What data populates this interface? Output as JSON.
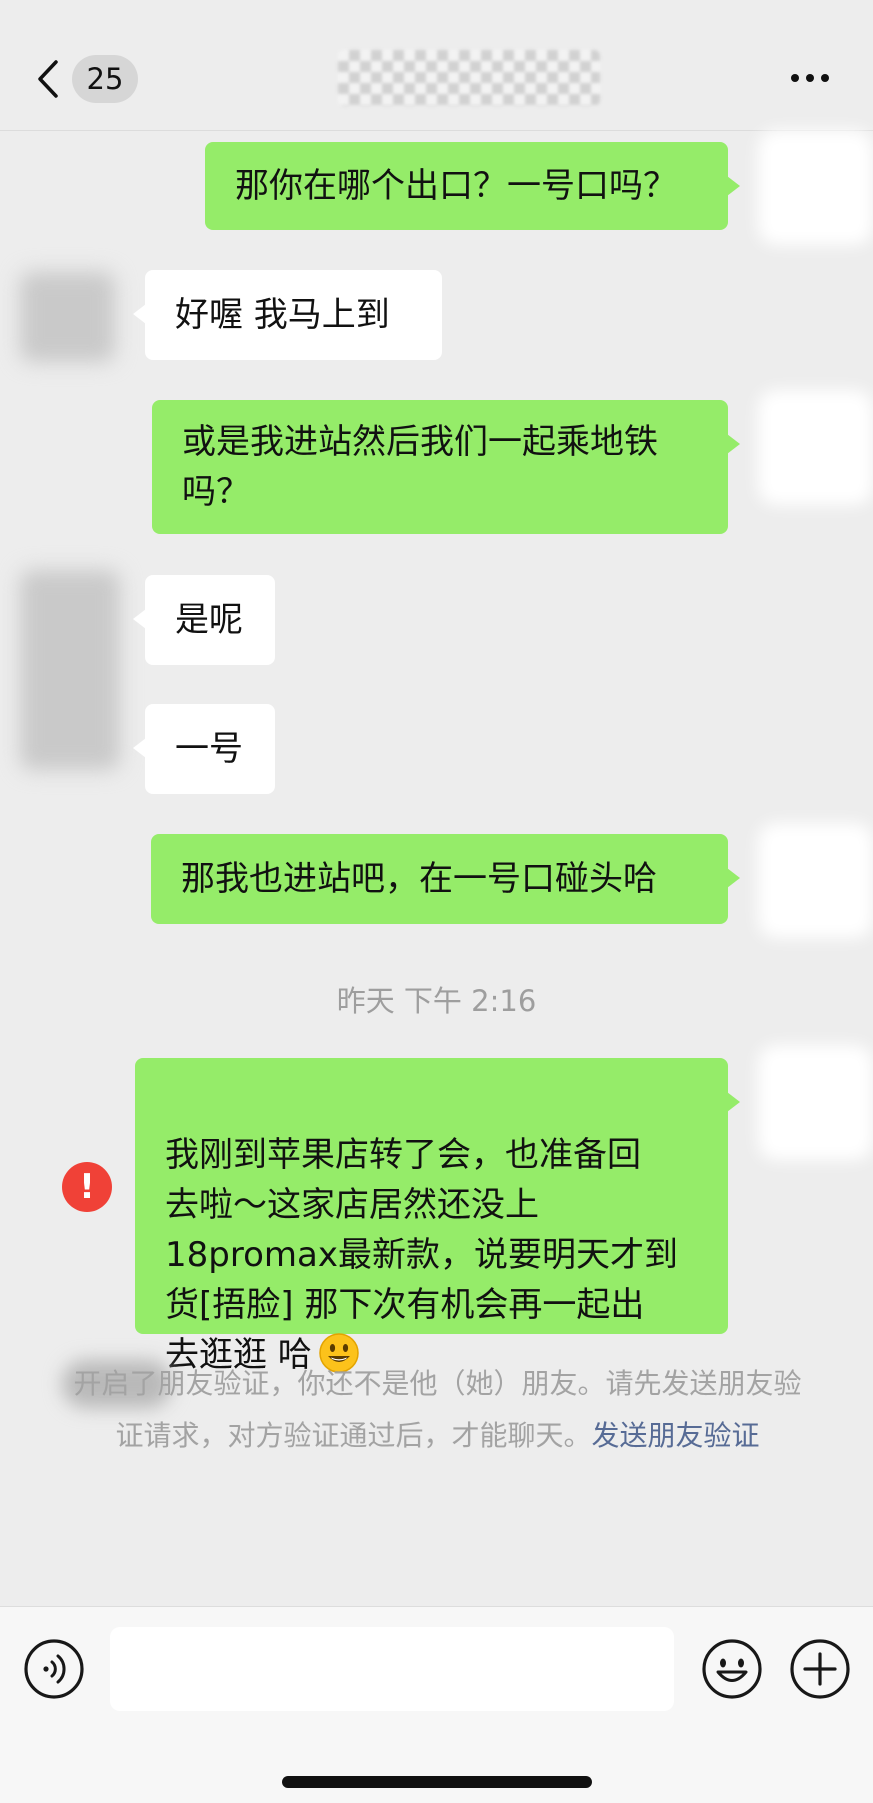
{
  "header": {
    "unread_count": "25"
  },
  "messages": [
    {
      "side": "sent",
      "text": "那你在哪个出口？一号口吗？"
    },
    {
      "side": "received",
      "text": "好喔 我马上到"
    },
    {
      "side": "sent",
      "text": "或是我进站然后我们一起乘地铁\n吗？"
    },
    {
      "side": "received",
      "text": "是呢"
    },
    {
      "side": "received",
      "text": "一号"
    },
    {
      "side": "sent",
      "text": "那我也进站吧，在一号口碰头哈"
    }
  ],
  "timestamp": "昨天 下午 2:16",
  "failed_message": {
    "text": "我刚到苹果店转了会，也准备回\n去啦～这家店居然还没上\n18promax最新款，说要明天才到\n货[捂脸] 那下次有机会再一起出\n去逛逛 哈",
    "emoji": "smiling-face",
    "status_icon": "exclamation-icon"
  },
  "system_notice": {
    "text": "开启了朋友验证，你还不是他（她）朋友。请先发送朋友验证请求，对方验证通过后，才能聊天。",
    "link_text": "发送朋友验证"
  },
  "input_bar": {
    "value": "",
    "placeholder": ""
  },
  "colors": {
    "background": "#ededed",
    "sent_bubble": "#95ec69",
    "received_bubble": "#ffffff",
    "error": "#f04137",
    "link": "#576b95"
  }
}
